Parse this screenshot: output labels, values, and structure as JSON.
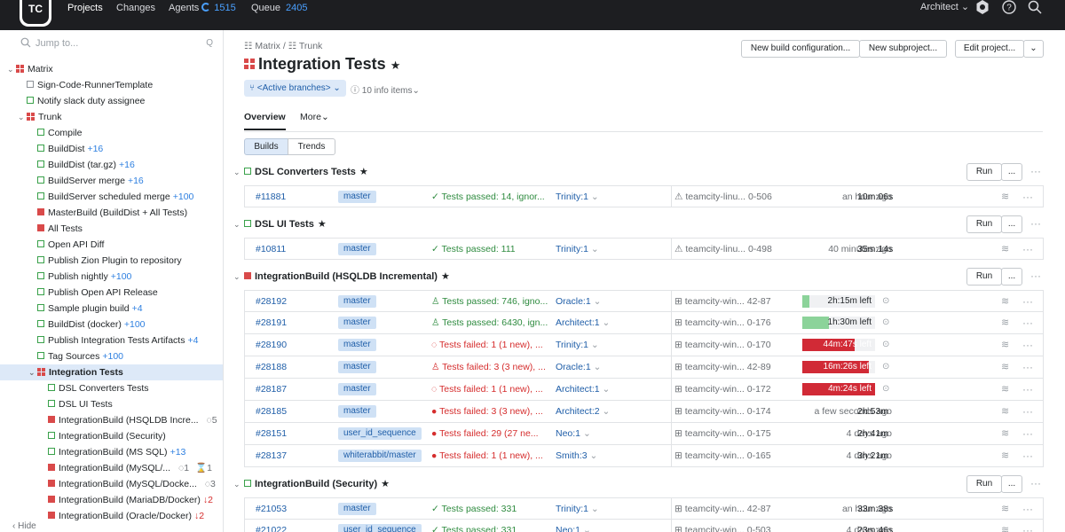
{
  "topbar": {
    "logo": "TC",
    "nav": [
      {
        "label": "Projects",
        "active": true
      },
      {
        "label": "Changes"
      },
      {
        "label": "Agents",
        "count": "1515"
      },
      {
        "label": "Queue",
        "count": "2405"
      }
    ],
    "user": "Architect"
  },
  "sidebar": {
    "search_placeholder": "Jump to...",
    "search_shortcut": "Q",
    "hide": "Hide",
    "items": [
      {
        "label": "Matrix",
        "type": "project"
      },
      {
        "label": "Sign-Code-RunnerTemplate",
        "type": "gray"
      },
      {
        "label": "Notify slack duty assignee",
        "type": "green"
      },
      {
        "label": "Trunk",
        "type": "project"
      },
      {
        "label": "Compile",
        "type": "green"
      },
      {
        "label": "BuildDist",
        "type": "green",
        "extra": "+16"
      },
      {
        "label": "BuildDist (tar.gz)",
        "type": "green",
        "extra": "+16"
      },
      {
        "label": "BuildServer merge",
        "type": "green",
        "extra": "+16"
      },
      {
        "label": "BuildServer scheduled merge",
        "type": "green",
        "extra": "+100"
      },
      {
        "label": "MasterBuild (BuildDist + All Tests)",
        "type": "red"
      },
      {
        "label": "All Tests",
        "type": "red"
      },
      {
        "label": "Open API Diff",
        "type": "green"
      },
      {
        "label": "Publish Zion Plugin to repository",
        "type": "green"
      },
      {
        "label": "Publish nightly",
        "type": "green",
        "extra": "+100"
      },
      {
        "label": "Publish Open API Release",
        "type": "green"
      },
      {
        "label": "Sample plugin build",
        "type": "green",
        "extra": "+4"
      },
      {
        "label": "BuildDist (docker)",
        "type": "green",
        "extra": "+100"
      },
      {
        "label": "Publish Integration Tests Artifacts",
        "type": "green",
        "extra": "+4"
      },
      {
        "label": "Tag Sources",
        "type": "green",
        "extra": "+100"
      },
      {
        "label": "Integration Tests",
        "type": "project"
      },
      {
        "label": "DSL Converters Tests",
        "type": "green"
      },
      {
        "label": "DSL UI Tests",
        "type": "green"
      },
      {
        "label": "IntegrationBuild (HSQLDB Incre...",
        "type": "red",
        "extra": "5"
      },
      {
        "label": "IntegrationBuild (Security)",
        "type": "green"
      },
      {
        "label": "IntegrationBuild (MS SQL)",
        "type": "green",
        "extra": "+13"
      },
      {
        "label": "IntegrationBuild (MySQL/...",
        "type": "red",
        "extra": "1",
        "extra2": "1"
      },
      {
        "label": "IntegrationBuild (MySQL/Docke...",
        "type": "red",
        "extra": "3"
      },
      {
        "label": "IntegrationBuild (MariaDB/Docker)",
        "type": "red",
        "extra": "↓2"
      },
      {
        "label": "IntegrationBuild (Oracle/Docker)",
        "type": "red",
        "extra": "↓2"
      }
    ]
  },
  "main": {
    "crumb_matrix": "Matrix",
    "crumb_sep": "/",
    "crumb_trunk": "Trunk",
    "title": "Integration Tests",
    "btn_new_config": "New build configuration...",
    "btn_new_subproject": "New subproject...",
    "btn_edit": "Edit project...",
    "branch_filter": "<Active branches>",
    "info_items": "10 info items",
    "tab_overview": "Overview",
    "tab_more": "More",
    "seg_builds": "Builds",
    "seg_trends": "Trends",
    "run": "Run",
    "dots": "...",
    "groups": [
      {
        "title": "DSL Converters Tests",
        "icon": "green",
        "rows": [
          {
            "num": "#11881",
            "branch": "master",
            "status": "Tests passed: 14, ignor...",
            "state": "ok",
            "agent": "Trinity:1",
            "host": "teamcity-linu... 0-506",
            "when": "an hour ago",
            "dur": "10m:06s"
          }
        ]
      },
      {
        "title": "DSL UI Tests",
        "icon": "green",
        "rows": [
          {
            "num": "#10811",
            "branch": "master",
            "status": "Tests passed: 111",
            "state": "ok",
            "agent": "Trinity:1",
            "host": "teamcity-linu... 0-498",
            "when": "40 minutes ago",
            "dur": "35m:14s"
          }
        ]
      },
      {
        "title": "IntegrationBuild (HSQLDB Incremental)",
        "icon": "red",
        "rows": [
          {
            "num": "#28192",
            "branch": "master",
            "status": "Tests passed: 746, igno...",
            "state": "ok-run",
            "agent": "Oracle:1",
            "host": "teamcity-win... 42-87",
            "progress": "2h:15m left",
            "progress_pct": 10,
            "progress_color": "g"
          },
          {
            "num": "#28191",
            "branch": "master",
            "status": "Tests passed: 6430, ign...",
            "state": "ok-run",
            "agent": "Architect:1",
            "host": "teamcity-win... 0-176",
            "progress": "1h:30m left",
            "progress_pct": 36,
            "progress_color": "g"
          },
          {
            "num": "#28190",
            "branch": "master",
            "status": "Tests failed: 1 (1 new), ...",
            "state": "bad-run",
            "agent": "Trinity:1",
            "host": "teamcity-win... 0-170",
            "progress": "44m:47s left",
            "progress_pct": 72,
            "progress_color": "r"
          },
          {
            "num": "#28188",
            "branch": "master",
            "status": "Tests failed: 3 (3 new), ...",
            "state": "bad-run",
            "agent": "Oracle:1",
            "host": "teamcity-win... 42-89",
            "progress": "16m:26s left",
            "progress_pct": 92,
            "progress_color": "r"
          },
          {
            "num": "#28187",
            "branch": "master",
            "status": "Tests failed: 1 (1 new), ...",
            "state": "bad-run",
            "agent": "Architect:1",
            "host": "teamcity-win... 0-172",
            "progress": "4m:24s left",
            "progress_pct": 100,
            "progress_color": "r"
          },
          {
            "num": "#28185",
            "branch": "master",
            "status": "Tests failed: 3 (3 new), ...",
            "state": "bad",
            "agent": "Architect:2",
            "host": "teamcity-win... 0-174",
            "when": "a few seconds ago",
            "dur": "2h:53m"
          },
          {
            "num": "#28151",
            "branch": "user_id_sequence",
            "status": "Tests failed: 29 (27 ne...",
            "state": "bad",
            "agent": "Neo:1",
            "host": "teamcity-win... 0-175",
            "when": "4 days ago",
            "dur": "2h:41m"
          },
          {
            "num": "#28137",
            "branch": "whiterabbit/master",
            "status": "Tests failed: 1 (1 new), ...",
            "state": "bad",
            "agent": "Smith:3",
            "host": "teamcity-win... 0-165",
            "when": "4 days ago",
            "dur": "3h:21m"
          }
        ]
      },
      {
        "title": "IntegrationBuild (Security)",
        "icon": "green",
        "rows": [
          {
            "num": "#21053",
            "branch": "master",
            "status": "Tests passed: 331",
            "state": "ok",
            "agent": "Trinity:1",
            "host": "teamcity-win... 42-87",
            "when": "an hour ago",
            "dur": "33m:38s"
          },
          {
            "num": "#21022",
            "branch": "user_id_sequence",
            "status": "Tests passed: 331",
            "state": "ok",
            "agent": "Neo:1",
            "host": "teamcity-win... 0-503",
            "when": "4 days ago",
            "dur": "23m:46s"
          }
        ]
      }
    ]
  },
  "colors": {
    "accent": "#2d7fe0",
    "success": "#2e8b3f",
    "failure": "#d52d2d",
    "topbar": "#1d1e21"
  }
}
